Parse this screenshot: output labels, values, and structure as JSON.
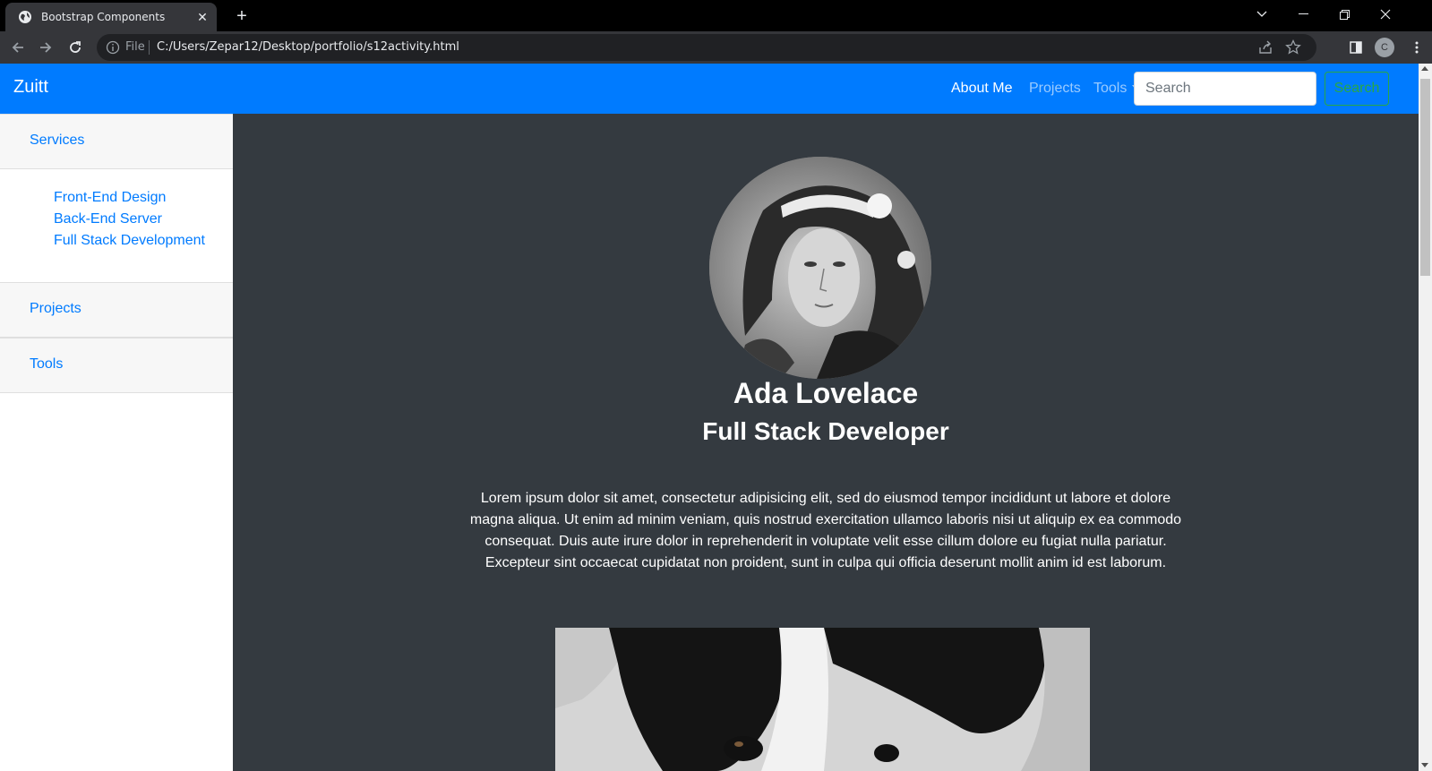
{
  "browser": {
    "tab_title": "Bootstrap Components",
    "omnibox_scheme": "File",
    "url": "C:/Users/Zepar12/Desktop/portfolio/s12activity.html",
    "profile_initial": "C"
  },
  "navbar": {
    "brand": "Zuitt",
    "links": [
      "About Me",
      "Projects",
      "Tools"
    ],
    "search_placeholder": "Search",
    "search_button": "Search",
    "bg_color": "#007bff"
  },
  "sidebar": {
    "sections": [
      {
        "label": "Services",
        "items": [
          "Front-End Design",
          "Back-End Server",
          "Full Stack Development"
        ]
      },
      {
        "label": "Projects"
      },
      {
        "label": "Tools"
      }
    ]
  },
  "profile": {
    "name": "Ada Lovelace",
    "role": "Full Stack Developer",
    "bio": "Lorem ipsum dolor sit amet, consectetur adipisicing elit, sed do eiusmod tempor incididunt ut labore et dolore magna aliqua. Ut enim ad minim veniam, quis nostrud exercitation ullamco laboris nisi ut aliquip ex ea commodo consequat. Duis aute irure dolor in reprehenderit in voluptate velit esse cillum dolore eu fugiat nulla pariatur. Excepteur sint occaecat cupidatat non proident, sunt in culpa qui officia deserunt mollit anim id est laborum."
  },
  "colors": {
    "page_bg": "#343a40",
    "link": "#007bff",
    "success": "#28a745"
  }
}
